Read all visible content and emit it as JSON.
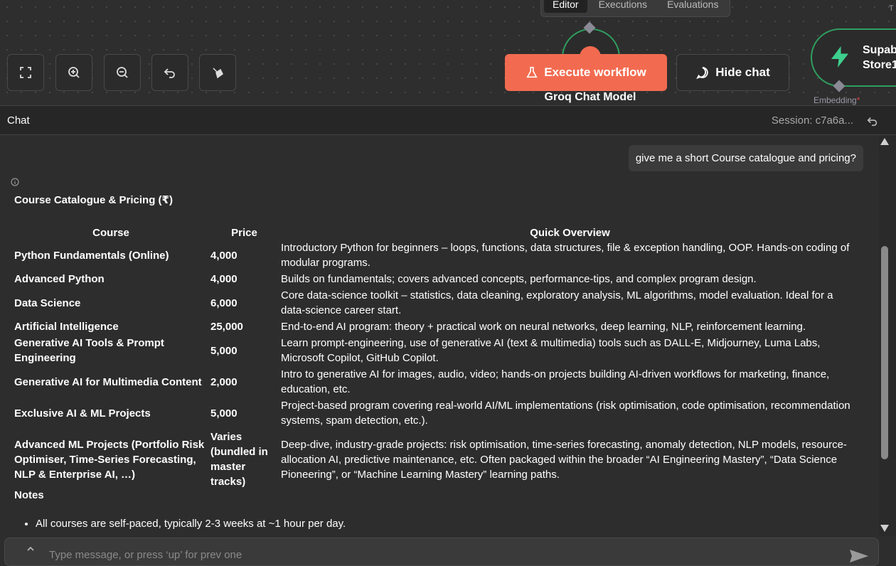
{
  "canvas": {
    "tabs": [
      "Editor",
      "Executions",
      "Evaluations"
    ],
    "node_label": "Groq Chat Model",
    "right_node_label": [
      "Supab",
      "Store1"
    ],
    "embedding_label": "Embedding",
    "embedding_required": "*",
    "corner_letter": "T",
    "execute_label": "Execute workflow",
    "hide_chat_label": "Hide chat"
  },
  "chat": {
    "title": "Chat",
    "session": "Session: c7a6a...",
    "user_message": "give me a short Course catalogue and pricing?",
    "response_title": "Course Catalogue & Pricing (₹)",
    "columns": [
      "Course",
      "Price",
      "Quick Overview"
    ],
    "rows": [
      {
        "course": "Python Fundamentals (Online)",
        "price": "4,000",
        "overview": "Introductory Python for beginners – loops, functions, data structures, file & exception handling, OOP. Hands-on coding of modular programs."
      },
      {
        "course": "Advanced Python",
        "price": "4,000",
        "overview": "Builds on fundamentals; covers advanced concepts, performance-tips, and complex program design."
      },
      {
        "course": "Data Science",
        "price": "6,000",
        "overview": "Core data-science toolkit – statistics, data cleaning, exploratory analysis, ML algorithms, model evaluation. Ideal for a data-science career start."
      },
      {
        "course": "Artificial Intelligence",
        "price": "25,000",
        "overview": "End-to-end AI program: theory + practical work on neural networks, deep learning, NLP, reinforcement learning."
      },
      {
        "course": "Generative AI Tools & Prompt Engineering",
        "price": "5,000",
        "overview": "Learn prompt-engineering, use of generative AI (text & multimedia) tools such as DALL-E, Midjourney, Luma Labs, Microsoft Copilot, GitHub Copilot."
      },
      {
        "course": "Generative AI for Multimedia Content",
        "price": "2,000",
        "overview": "Intro to generative AI for images, audio, video; hands-on projects building AI-driven workflows for marketing, finance, education, etc."
      },
      {
        "course": "Exclusive AI & ML Projects",
        "price": "5,000",
        "overview": "Project-based program covering real-world AI/ML implementations (risk optimisation, code optimisation, recommendation systems, spam detection, etc.)."
      },
      {
        "course": "Advanced ML Projects (Portfolio Risk Optimiser, Time-Series Forecasting, NLP & Enterprise AI, …)",
        "price": "Varies (bundled in master tracks)",
        "overview": "Deep-dive, industry-grade projects: risk optimisation, time-series forecasting, anomaly detection, NLP models, resource-allocation AI, predictive maintenance, etc. Often packaged within the broader “AI Engineering Mastery”, “Data Science Pioneering”, or “Machine Learning Mastery” learning paths."
      }
    ],
    "notes_title": "Notes",
    "notes": [
      "All courses are self-paced, typically 2-3 weeks at ~1 hour per day."
    ],
    "input_placeholder": "Type message, or press ‘up’ for prev one"
  },
  "colors": {
    "accent": "#f26b50",
    "node_border": "#2f9e5f",
    "supabase_green": "#3ecf8e",
    "background": "#2d2d2d"
  },
  "icons": [
    "fit-view-icon",
    "zoom-in-icon",
    "zoom-out-icon",
    "undo-icon",
    "clean-up-icon",
    "flask-icon",
    "chat-bubble-icon",
    "reset-icon",
    "info-icon",
    "chevron-up-icon",
    "send-icon",
    "supabase-bolt-icon"
  ]
}
